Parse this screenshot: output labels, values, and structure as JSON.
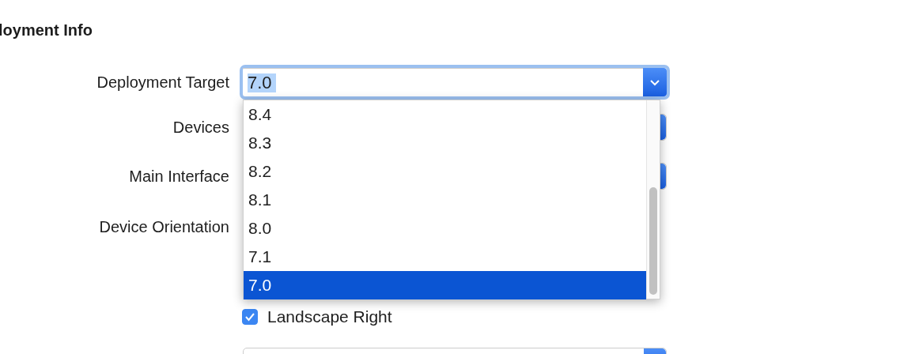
{
  "section": {
    "title": "loyment Info"
  },
  "deployment_target": {
    "label": "Deployment Target",
    "value": "7.0",
    "value_highlighted": true,
    "expanded": true,
    "options": [
      {
        "label": "8.4",
        "selected": false
      },
      {
        "label": "8.3",
        "selected": false
      },
      {
        "label": "8.2",
        "selected": false
      },
      {
        "label": "8.1",
        "selected": false
      },
      {
        "label": "8.0",
        "selected": false
      },
      {
        "label": "7.1",
        "selected": false
      },
      {
        "label": "7.0",
        "selected": true
      }
    ]
  },
  "devices": {
    "label": "Devices"
  },
  "main_interface": {
    "label": "Main Interface"
  },
  "device_orientation": {
    "label": "Device Orientation",
    "options": [
      {
        "label": "Landscape Right",
        "checked": true
      }
    ]
  }
}
